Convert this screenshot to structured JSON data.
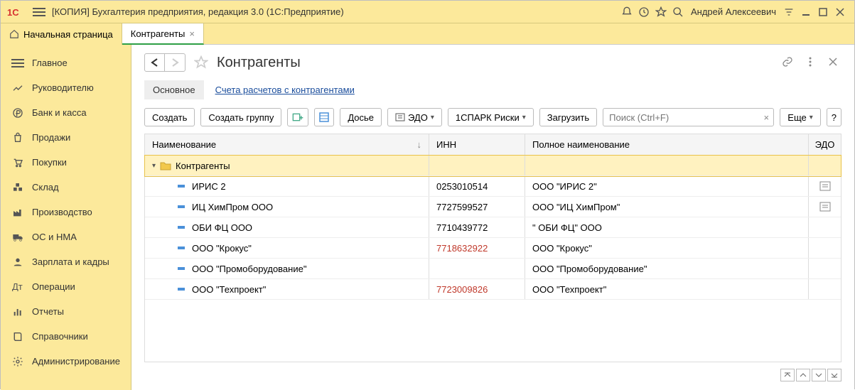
{
  "titlebar": {
    "app_title": "[КОПИЯ] Бухгалтерия предприятия, редакция 3.0  (1С:Предприятие)",
    "user_name": "Андрей Алексеевич"
  },
  "tabs": {
    "home_label": "Начальная страница",
    "current_label": "Контрагенты"
  },
  "sidebar": {
    "items": [
      {
        "label": "Главное"
      },
      {
        "label": "Руководителю"
      },
      {
        "label": "Банк и касса"
      },
      {
        "label": "Продажи"
      },
      {
        "label": "Покупки"
      },
      {
        "label": "Склад"
      },
      {
        "label": "Производство"
      },
      {
        "label": "ОС и НМА"
      },
      {
        "label": "Зарплата и кадры"
      },
      {
        "label": "Операции"
      },
      {
        "label": "Отчеты"
      },
      {
        "label": "Справочники"
      },
      {
        "label": "Администрирование"
      }
    ]
  },
  "page": {
    "title": "Контрагенты",
    "subtabs": {
      "main": "Основное",
      "accounts": "Счета расчетов с контрагентами"
    },
    "toolbar": {
      "create": "Создать",
      "create_group": "Создать группу",
      "dossier": "Досье",
      "edo": "ЭДО",
      "spark": "1СПАРК Риски",
      "load": "Загрузить",
      "more": "Еще",
      "help": "?"
    },
    "search_placeholder": "Поиск (Ctrl+F)",
    "grid": {
      "headers": {
        "name": "Наименование",
        "inn": "ИНН",
        "full": "Полное наименование",
        "edo": "ЭДО"
      },
      "group_label": "Контрагенты",
      "rows": [
        {
          "name": "ИРИС 2",
          "inn": "0253010514",
          "full": "ООО \"ИРИС 2\"",
          "inn_red": false,
          "edo": true
        },
        {
          "name": "ИЦ ХимПром ООО",
          "inn": "7727599527",
          "full": "ООО \"ИЦ ХимПром\"",
          "inn_red": false,
          "edo": true
        },
        {
          "name": "ОБИ ФЦ ООО",
          "inn": "7710439772",
          "full": "\" ОБИ ФЦ\" ООО",
          "inn_red": false,
          "edo": false
        },
        {
          "name": "ООО \"Крокус\"",
          "inn": "7718632922",
          "full": "ООО \"Крокус\"",
          "inn_red": true,
          "edo": false
        },
        {
          "name": "ООО \"Промоборудование\"",
          "inn": "",
          "full": "ООО \"Промоборудование\"",
          "inn_red": false,
          "edo": false
        },
        {
          "name": "ООО \"Техпроект\"",
          "inn": "7723009826",
          "full": "ООО \"Техпроект\"",
          "inn_red": true,
          "edo": false
        }
      ]
    }
  }
}
